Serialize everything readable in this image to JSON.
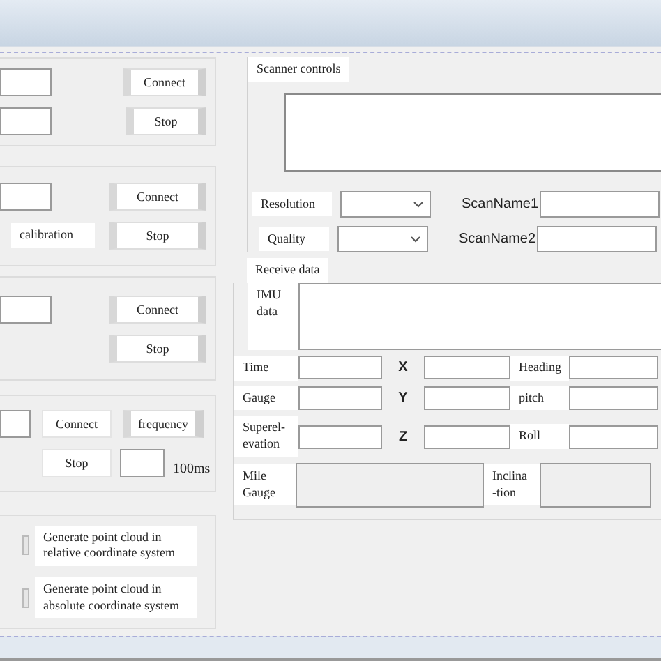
{
  "connection_groups": [
    {
      "connect": "Connect",
      "stop": "Stop"
    },
    {
      "connect": "Connect",
      "label": "calibration",
      "stop": "Stop"
    },
    {
      "connect": "Connect",
      "stop": "Stop"
    }
  ],
  "frequency_group": {
    "connect": "Connect",
    "frequency": "frequency",
    "stop": "Stop",
    "unit": "100ms"
  },
  "point_cloud_options": [
    {
      "label": "Generate point cloud in relative coordinate system",
      "checked": false
    },
    {
      "label": "Generate point cloud in absolute coordinate system",
      "checked": false
    }
  ],
  "scanner_controls": {
    "title": "Scanner controls",
    "settings": [
      {
        "label": "Resolution",
        "name_label": "ScanName1"
      },
      {
        "label": "Quality",
        "name_label": "ScanName2"
      }
    ]
  },
  "receive_data": {
    "title": "Receive data",
    "imu_label": "IMU data",
    "rows": [
      {
        "label": "Time",
        "axis": "X",
        "angle": "Heading"
      },
      {
        "label": "Gauge",
        "axis": "Y",
        "angle": "pitch"
      },
      {
        "label": "Superel-evation",
        "axis": "Z",
        "angle": "Roll"
      }
    ],
    "mile_label": "Mile Gauge",
    "inclination_label": "Inclina -tion"
  }
}
